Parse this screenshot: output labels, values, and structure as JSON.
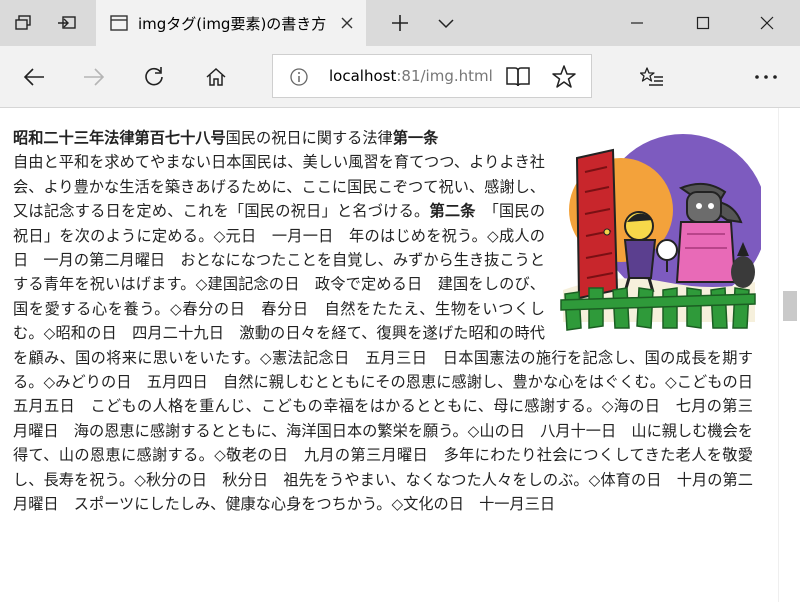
{
  "browser": {
    "tab": {
      "title": "imgタグ(img要素)の書き方",
      "favicon": "page-icon"
    },
    "address": {
      "host": "localhost",
      "rest": ":81/img.html"
    },
    "icons": {
      "tab_preview": "tab-preview-icon",
      "set_aside": "set-aside-tabs-icon",
      "close_tab": "close-icon",
      "new_tab": "plus-icon",
      "tab_list": "chevron-down-icon",
      "minimize": "minimize-icon",
      "maximize": "maximize-icon",
      "close_window": "close-icon",
      "back": "back-arrow-icon",
      "forward": "forward-arrow-icon",
      "refresh": "refresh-icon",
      "home": "home-icon",
      "info": "info-icon",
      "reading_view": "book-icon",
      "favorite": "star-icon",
      "hub": "favorites-hub-icon",
      "more": "more-icon"
    },
    "colors": {
      "titlebar": "#dadada",
      "toolbar": "#f2f2f2",
      "illustration_moon": "#7d5bbf",
      "illustration_sun": "#f3a23b",
      "illustration_door": "#c8262c",
      "illustration_fence": "#2f9a3a"
    }
  },
  "article": {
    "heading": "昭和二十三年法律第百七十八号",
    "intro": "国民の祝日に関する法律",
    "article1": "第一条",
    "para1": "自由と平和を求めてやまない日本国民は、美しい風習を育てつつ、よりよき社会、より豊かな生活を築きあげるために、ここに国民こぞつて祝い、感謝し、又は記念する日を定め、これを「国民の祝日」と名づける。",
    "article2": "第二条",
    "para2": "「国民の祝日」を次のように定める。◇元日　一月一日　年のはじめを祝う。◇成人の日　一月の第二月曜日　おとなになつたことを自覚し、みずから生き抜こうとする青年を祝いはげます。◇建国記念の日　政令で定める日　建国をしのび、国を愛する心を養う。◇春分の日　春分日　自然をたたえ、生物をいつくしむ。◇昭和の日　四月二十九日　激動の日々を経て、復興を遂げた昭和の時代を顧み、国の将来に思いをいたす。◇憲法記念日　五月三日　日本国憲法の施行を記念し、国の成長を期する。◇みどりの日　五月四日　自然に親しむとともにその恩恵に感謝し、豊かな心をはぐくむ。◇こどもの日　五月五日　こどもの人格を重んじ、こどもの幸福をはかるとともに、母に感謝する。◇海の日　七月の第三月曜日　海の恩恵に感謝するとともに、海洋国日本の繁栄を願う。◇山の日　八月十一日　山に親しむ機会を得て、山の恩恵に感謝する。◇敬老の日　九月の第三月曜日　多年にわたり社会につくしてきた老人を敬愛し、長寿を祝う。◇秋分の日　秋分日　祖先をうやまい、なくなつた人々をしのぶ。◇体育の日　十月の第二月曜日　スポーツにしたしみ、健康な心身をつちかう。◇文化の日　十一月三日"
  }
}
